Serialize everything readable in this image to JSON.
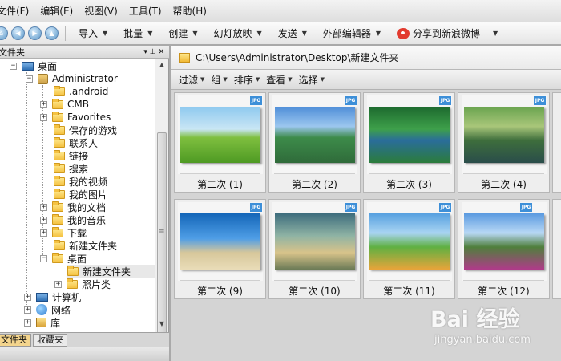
{
  "menubar": {
    "items": [
      "文件(F)",
      "编辑(E)",
      "视图(V)",
      "工具(T)",
      "帮助(H)"
    ]
  },
  "toolbar": {
    "items": [
      "导入",
      "批量",
      "创建",
      "幻灯放映",
      "发送",
      "外部编辑器",
      "分享到新浪微博"
    ]
  },
  "folder_panel": {
    "title": "文件夹",
    "pin_glyph": "▾ ⊥ ✕"
  },
  "tree": {
    "items": [
      {
        "label": "桌面",
        "expander": "−"
      },
      {
        "label": "Administrator",
        "expander": "−"
      },
      {
        "label": ".android",
        "expander": ""
      },
      {
        "label": "CMB",
        "expander": "+"
      },
      {
        "label": "Favorites",
        "expander": "+"
      },
      {
        "label": "保存的游戏",
        "expander": ""
      },
      {
        "label": "联系人",
        "expander": ""
      },
      {
        "label": "链接",
        "expander": ""
      },
      {
        "label": "搜索",
        "expander": ""
      },
      {
        "label": "我的视频",
        "expander": ""
      },
      {
        "label": "我的图片",
        "expander": ""
      },
      {
        "label": "我的文档",
        "expander": "+"
      },
      {
        "label": "我的音乐",
        "expander": "+"
      },
      {
        "label": "下载",
        "expander": "+"
      },
      {
        "label": "新建文件夹",
        "expander": ""
      },
      {
        "label": "桌面",
        "expander": "−"
      },
      {
        "label": "新建文件夹",
        "expander": ""
      },
      {
        "label": "照片类",
        "expander": "+"
      },
      {
        "label": "计算机",
        "expander": "+"
      },
      {
        "label": "网络",
        "expander": "+"
      },
      {
        "label": "库",
        "expander": "+"
      }
    ]
  },
  "bottom_tabs": [
    "文件夹",
    "收藏夹"
  ],
  "address": {
    "path": "C:\\Users\\Administrator\\Desktop\\新建文件夹"
  },
  "viewbar": {
    "items": [
      "过滤",
      "组",
      "排序",
      "查看",
      "选择"
    ]
  },
  "thumbnails": [
    {
      "caption": "第二次 (1)",
      "badge": "JPG"
    },
    {
      "caption": "第二次 (2)",
      "badge": "JPG"
    },
    {
      "caption": "第二次 (3)",
      "badge": "JPG"
    },
    {
      "caption": "第二次 (4)",
      "badge": "JPG"
    },
    {
      "caption": "第二次 (9)",
      "badge": "JPG"
    },
    {
      "caption": "第二次 (10)",
      "badge": "JPG"
    },
    {
      "caption": "第二次 (11)",
      "badge": "JPG"
    },
    {
      "caption": "第二次 (12)",
      "badge": "JPG"
    }
  ],
  "watermark": {
    "logo": "Bai 经验",
    "url": "jingyan.baidu.com"
  }
}
